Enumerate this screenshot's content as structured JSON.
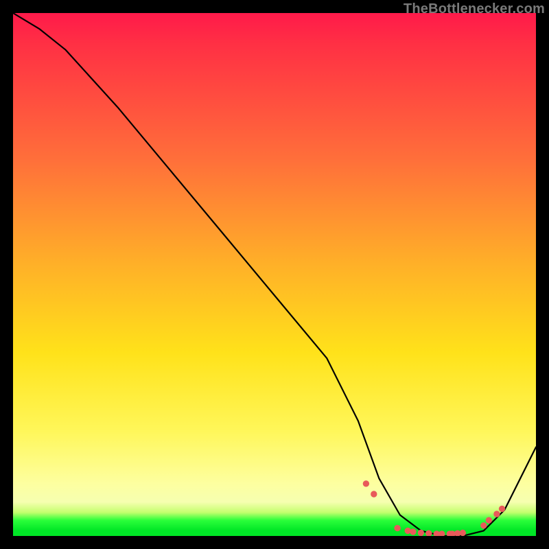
{
  "source_label": "TheBottlenecker.com",
  "chart_data": {
    "type": "line",
    "title": "",
    "xlabel": "",
    "ylabel": "",
    "xlim": [
      0,
      100
    ],
    "ylim": [
      0,
      100
    ],
    "series": [
      {
        "name": "bottleneck-curve",
        "x": [
          0,
          5,
          10,
          20,
          30,
          40,
          50,
          60,
          66,
          70,
          74,
          78,
          82,
          86,
          90,
          94,
          100
        ],
        "y": [
          100,
          97,
          93,
          82,
          70,
          58,
          46,
          34,
          22,
          11,
          4,
          1,
          0,
          0,
          1,
          5,
          17
        ]
      }
    ],
    "markers": {
      "name": "highlight-dots",
      "x": [
        67.5,
        69.0,
        73.5,
        75.5,
        76.5,
        78.0,
        79.5,
        81.0,
        82.0,
        83.5,
        84.0,
        85.0,
        86.0,
        90.0,
        91.0,
        92.5,
        93.5
      ],
      "y": [
        10.0,
        8.0,
        1.5,
        1.0,
        0.8,
        0.6,
        0.5,
        0.4,
        0.4,
        0.4,
        0.4,
        0.5,
        0.6,
        2.0,
        3.0,
        4.2,
        5.2
      ]
    },
    "gradient_colors": {
      "top": "#ff1a4a",
      "mid_upper": "#ff6f3a",
      "mid": "#ffe21a",
      "bottom": "#00e626"
    }
  }
}
